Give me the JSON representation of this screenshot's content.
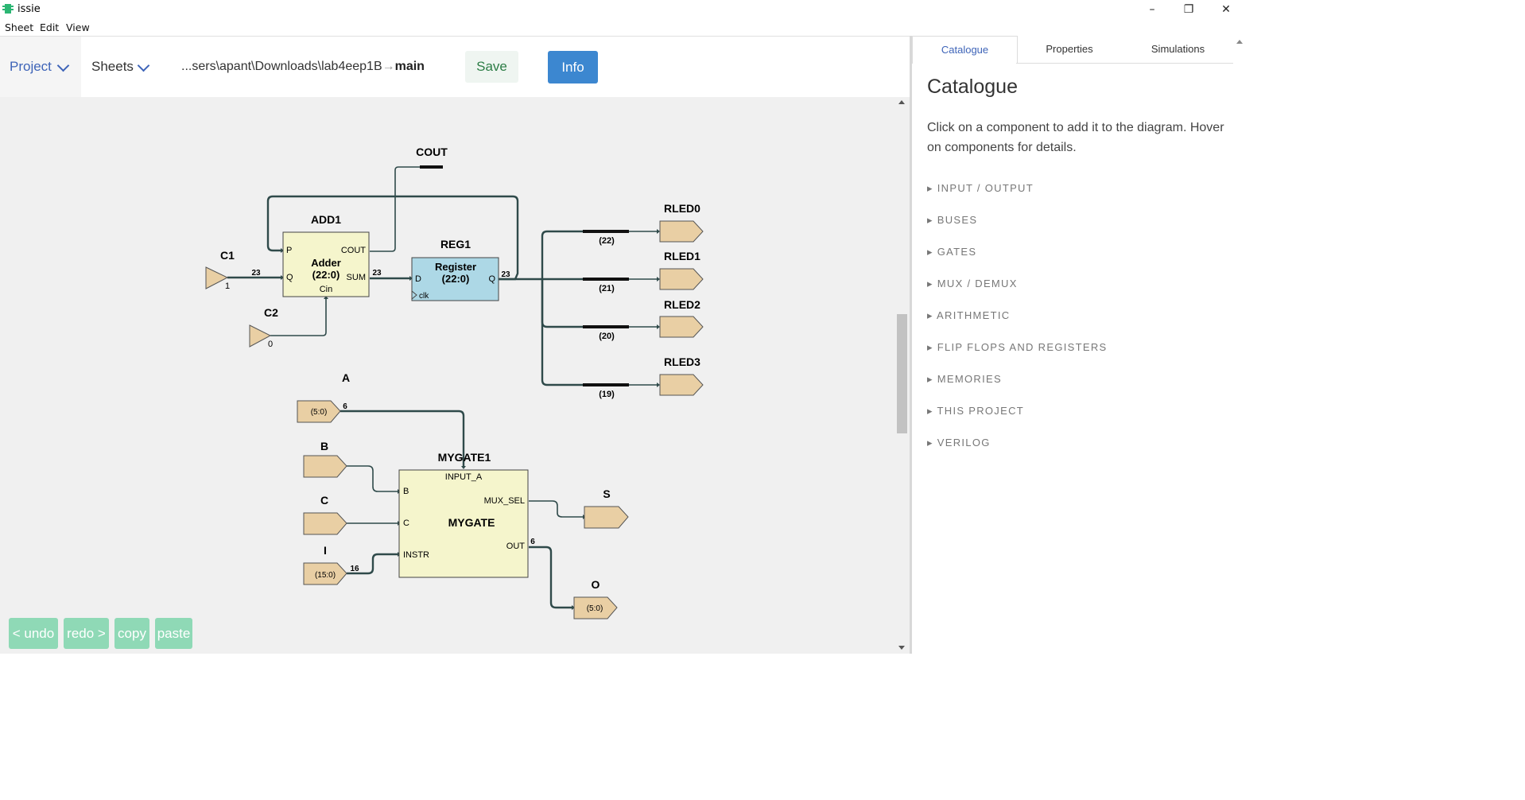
{
  "window": {
    "title": "issie",
    "minimize": "–",
    "maximize": "❐",
    "close": "✕"
  },
  "menu": {
    "sheet": "Sheet",
    "edit": "Edit",
    "view": "View"
  },
  "toolbar": {
    "project": "Project",
    "sheets": "Sheets",
    "path_prefix": "...sers\\apant\\Downloads\\lab4eep1B",
    "path_arrow": "→",
    "path_sheet": "main",
    "save": "Save",
    "info": "Info"
  },
  "tabs": {
    "catalogue": "Catalogue",
    "properties": "Properties",
    "simulations": "Simulations"
  },
  "catalogue": {
    "title": "Catalogue",
    "description": "Click on a component to add it to the diagram. Hover on components for details.",
    "items": [
      "INPUT / OUTPUT",
      "BUSES",
      "GATES",
      "MUX / DEMUX",
      "ARITHMETIC",
      "FLIP FLOPS AND REGISTERS",
      "MEMORIES",
      "THIS PROJECT",
      "VERILOG"
    ]
  },
  "edit_buttons": {
    "undo": "< undo",
    "redo": "redo >",
    "copy": "copy",
    "paste": "paste"
  },
  "diagram": {
    "c1": {
      "label": "C1",
      "value": "1"
    },
    "c2": {
      "label": "C2",
      "value": "0"
    },
    "add1": {
      "label": "ADD1",
      "title": "Adder",
      "range": "(22:0)",
      "p": "P",
      "q": "Q",
      "cout": "COUT",
      "sum": "SUM",
      "cin": "Cin"
    },
    "cout_label": "COUT",
    "reg1": {
      "label": "REG1",
      "title": "Register",
      "range": "(22:0)",
      "d": "D",
      "q": "Q",
      "clk": "clk"
    },
    "widths": {
      "c1_w": "23",
      "sum_w": "23",
      "reg_w": "23",
      "a_w": "6",
      "out_w": "6",
      "instr_w": "16"
    },
    "rleds": [
      {
        "label": "RLED0",
        "bit": "(22)"
      },
      {
        "label": "RLED1",
        "bit": "(21)"
      },
      {
        "label": "RLED2",
        "bit": "(20)"
      },
      {
        "label": "RLED3",
        "bit": "(19)"
      }
    ],
    "a": {
      "label": "A",
      "range": "(5:0)"
    },
    "b": {
      "label": "B"
    },
    "c": {
      "label": "C"
    },
    "i": {
      "label": "I",
      "range": "(15:0)"
    },
    "mygate": {
      "label": "MYGATE1",
      "title": "MYGATE",
      "input_a": "INPUT_A",
      "b": "B",
      "c": "C",
      "instr": "INSTR",
      "mux_sel": "MUX_SEL",
      "out": "OUT"
    },
    "s": {
      "label": "S"
    },
    "o": {
      "label": "O",
      "range": "(5:0)"
    }
  },
  "colors": {
    "accent": "#3e64b8",
    "info": "#3c87d0",
    "save_text": "#2d7d46",
    "edit_button": "#8fd9b6",
    "wire": "#2f4a4a",
    "io_fill": "#e9cfa4",
    "adder_fill": "#f5f5cc",
    "register_fill": "#add8e6"
  }
}
